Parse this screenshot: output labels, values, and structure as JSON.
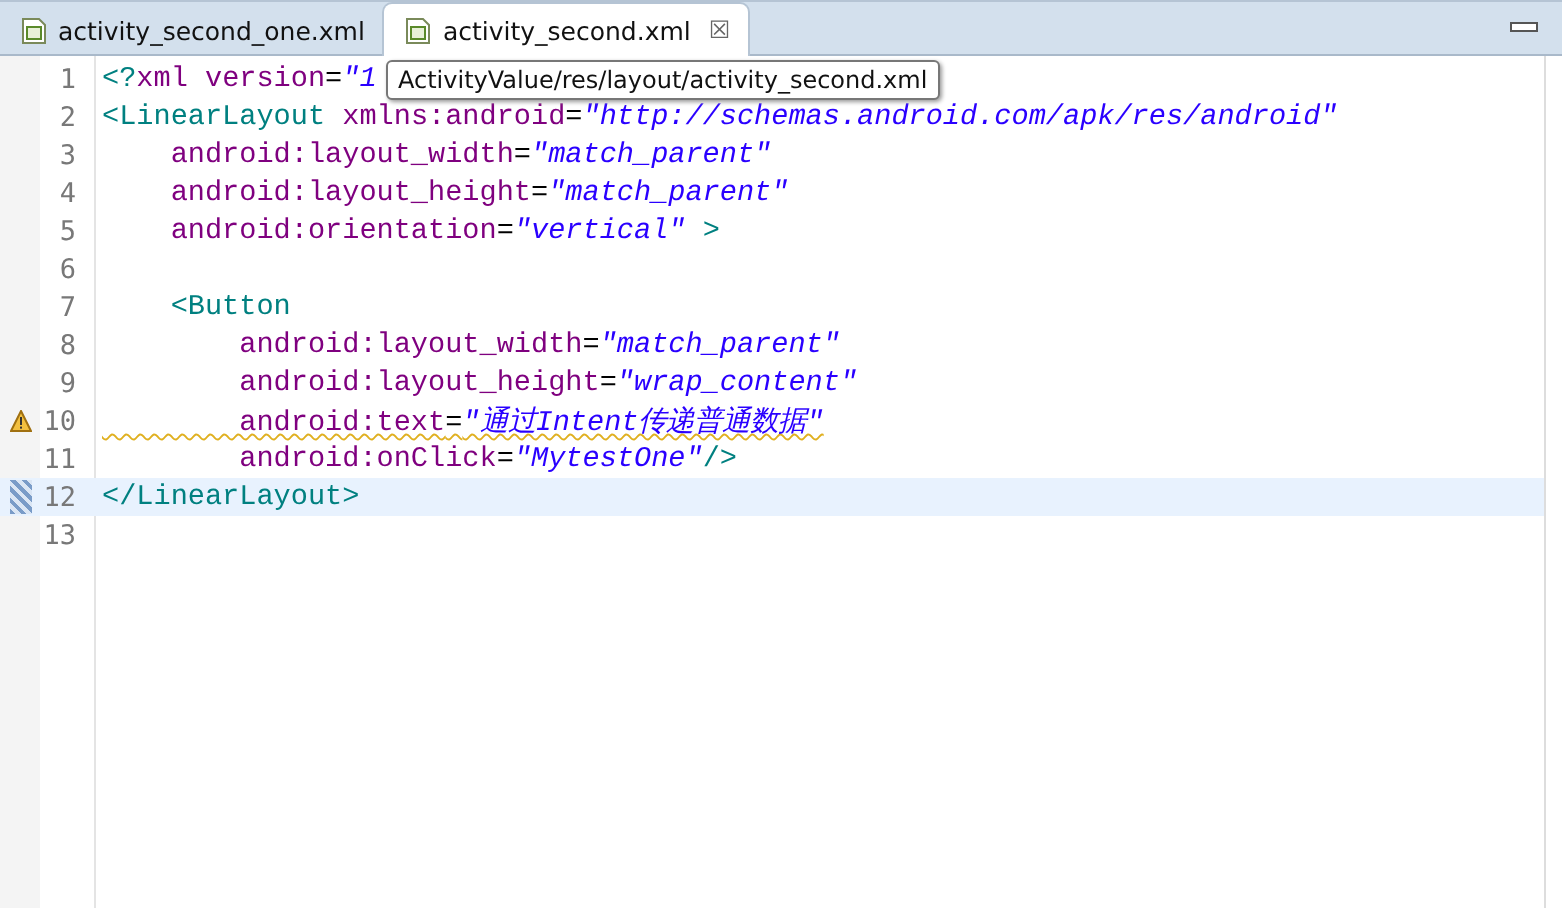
{
  "tabs": [
    {
      "label": "activity_second_one.xml",
      "selected": false
    },
    {
      "label": "activity_second.xml",
      "selected": true,
      "close": "☒"
    }
  ],
  "tooltip": "ActivityValue/res/layout/activity_second.xml",
  "lines": [
    {
      "number": "1",
      "current": false,
      "warning": false,
      "tokens": [
        {
          "kind": "tag",
          "text": "<?"
        },
        {
          "kind": "attr",
          "text": "xml version"
        },
        {
          "kind": "plain",
          "text": "="
        },
        {
          "kind": "value",
          "text": "\"1"
        }
      ]
    },
    {
      "number": "2",
      "current": false,
      "warning": false,
      "tokens": [
        {
          "kind": "tag",
          "text": "<LinearLayout "
        },
        {
          "kind": "attr",
          "text": "xmlns:android"
        },
        {
          "kind": "plain",
          "text": "="
        },
        {
          "kind": "value",
          "text": "\"http://schemas.android.com/apk/res/android\""
        }
      ]
    },
    {
      "number": "3",
      "current": false,
      "warning": false,
      "tokens": [
        {
          "kind": "attr",
          "text": "    android:layout_width"
        },
        {
          "kind": "plain",
          "text": "="
        },
        {
          "kind": "value",
          "text": "\"match_parent\""
        }
      ]
    },
    {
      "number": "4",
      "current": false,
      "warning": false,
      "tokens": [
        {
          "kind": "attr",
          "text": "    android:layout_height"
        },
        {
          "kind": "plain",
          "text": "="
        },
        {
          "kind": "value",
          "text": "\"match_parent\""
        }
      ]
    },
    {
      "number": "5",
      "current": false,
      "warning": false,
      "tokens": [
        {
          "kind": "attr",
          "text": "    android:orientation"
        },
        {
          "kind": "plain",
          "text": "="
        },
        {
          "kind": "value",
          "text": "\"vertical\""
        },
        {
          "kind": "tag",
          "text": " >"
        }
      ]
    },
    {
      "number": "6",
      "current": false,
      "warning": false
    },
    {
      "number": "7",
      "current": false,
      "warning": false,
      "tokens": [
        {
          "kind": "tag",
          "text": "    <Button"
        }
      ]
    },
    {
      "number": "8",
      "current": false,
      "warning": false,
      "tokens": [
        {
          "kind": "attr",
          "text": "        android:layout_width"
        },
        {
          "kind": "plain",
          "text": "="
        },
        {
          "kind": "value",
          "text": "\"match_parent\""
        }
      ]
    },
    {
      "number": "9",
      "current": false,
      "warning": false,
      "tokens": [
        {
          "kind": "attr",
          "text": "        android:layout_height"
        },
        {
          "kind": "plain",
          "text": "="
        },
        {
          "kind": "value",
          "text": "\"wrap_content\""
        }
      ]
    },
    {
      "number": "10",
      "current": false,
      "warning": true,
      "tokens": [
        {
          "kind": "attr",
          "text": "        android:text"
        },
        {
          "kind": "plain",
          "text": "="
        },
        {
          "kind": "value",
          "text": "\"通过Intent传递普通数据\""
        }
      ]
    },
    {
      "number": "11",
      "current": false,
      "warning": false,
      "tokens": [
        {
          "kind": "attr",
          "text": "        android:onClick"
        },
        {
          "kind": "plain",
          "text": "="
        },
        {
          "kind": "value",
          "text": "\"MytestOne\""
        },
        {
          "kind": "tag",
          "text": "/>"
        }
      ]
    },
    {
      "number": "12",
      "current": true,
      "warning": false,
      "tokens": [
        {
          "kind": "tag",
          "text": "</LinearLayout>"
        }
      ]
    },
    {
      "number": "13",
      "current": false,
      "warning": false
    }
  ]
}
